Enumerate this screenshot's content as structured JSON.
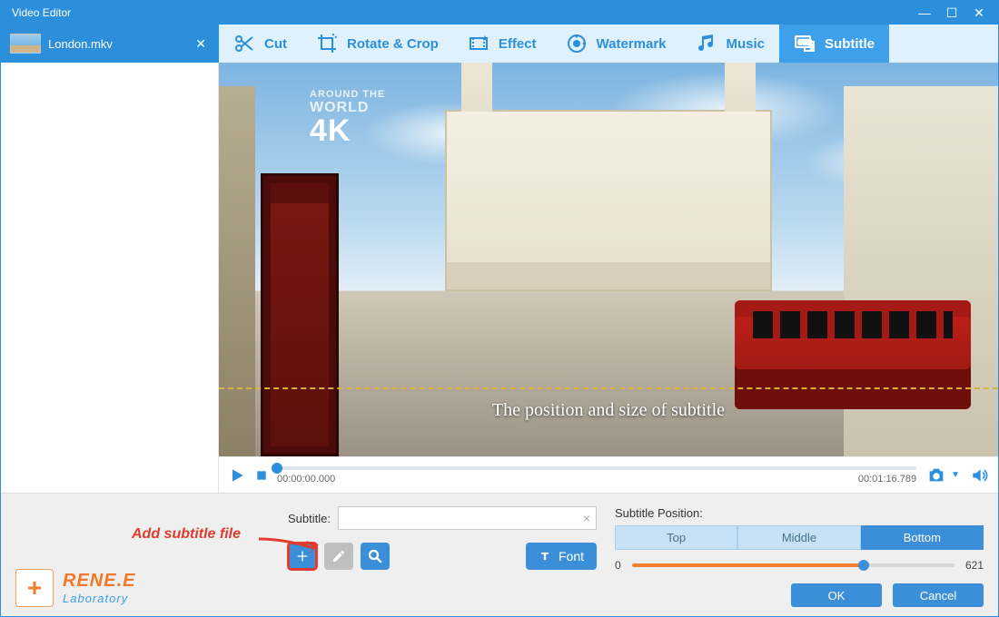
{
  "window": {
    "title": "Video Editor"
  },
  "filetab": {
    "name": "London.mkv"
  },
  "toolbar": {
    "items": [
      {
        "id": "cut",
        "label": "Cut"
      },
      {
        "id": "rotate",
        "label": "Rotate & Crop"
      },
      {
        "id": "effect",
        "label": "Effect"
      },
      {
        "id": "watermark",
        "label": "Watermark"
      },
      {
        "id": "music",
        "label": "Music"
      },
      {
        "id": "subtitle",
        "label": "Subtitle"
      }
    ],
    "active": "subtitle"
  },
  "preview": {
    "overlay_text": "The position and size of subtitle",
    "watermark_top": "AROUND THE",
    "watermark_mid": "WORLD",
    "watermark_big": "4K",
    "time_current": "00:00:00.000",
    "time_total": "00:01:16.789"
  },
  "subtitle_panel": {
    "label": "Subtitle:",
    "value": "",
    "font_btn": "Font",
    "annotation": "Add subtitle file"
  },
  "position_panel": {
    "label": "Subtitle Position:",
    "options": [
      "Top",
      "Middle",
      "Bottom"
    ],
    "active": "Bottom",
    "slider_min": "0",
    "slider_max": "621"
  },
  "footer": {
    "ok": "OK",
    "cancel": "Cancel"
  },
  "logo": {
    "line1": "RENE.E",
    "line2": "Laboratory"
  }
}
